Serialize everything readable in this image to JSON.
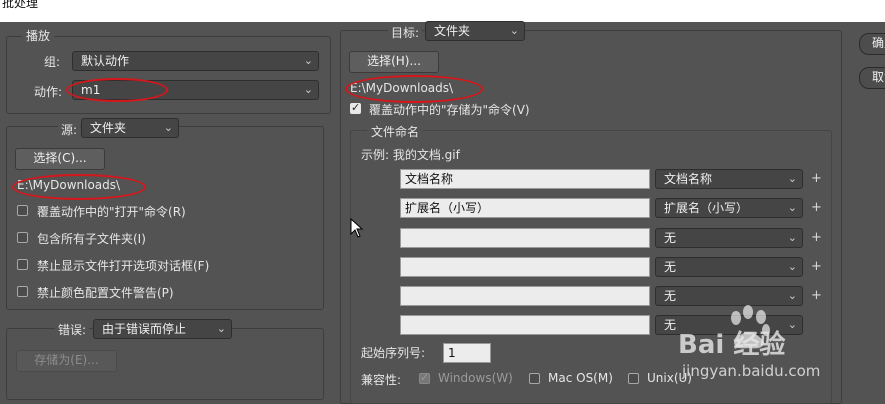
{
  "window_title": "批处理",
  "playback": {
    "legend": "播放",
    "group_label": "组:",
    "group_value": "默认动作",
    "action_label": "动作:",
    "action_value": "m1"
  },
  "source": {
    "label": "源:",
    "value": "文件夹",
    "choose_button": "选择(C)...",
    "path": "E:\\MyDownloads\\",
    "options": [
      "覆盖动作中的\"打开\"命令(R)",
      "包含所有子文件夹(I)",
      "禁止显示文件打开选项对话框(F)",
      "禁止颜色配置文件警告(P)"
    ]
  },
  "errors": {
    "label": "错误:",
    "value": "由于错误而停止",
    "save_as_button": "存储为(E)..."
  },
  "destination": {
    "label": "目标:",
    "value": "文件夹",
    "choose_button": "选择(H)...",
    "path": "E:\\MyDownloads\\",
    "override_save_as": "覆盖动作中的\"存储为\"命令(V)",
    "override_checked": true
  },
  "file_naming": {
    "legend": "文件命名",
    "example": "示例: 我的文档.gif",
    "rows": [
      {
        "text": "文档名称",
        "select": "文档名称"
      },
      {
        "text": "扩展名（小写）",
        "select": "扩展名（小写）"
      },
      {
        "text": "",
        "select": "无"
      },
      {
        "text": "",
        "select": "无"
      },
      {
        "text": "",
        "select": "无"
      },
      {
        "text": "",
        "select": "无"
      }
    ],
    "serial_label": "起始序列号:",
    "serial_value": "1",
    "compat_label": "兼容性:",
    "compat": [
      {
        "label": "Windows(W)",
        "checked": true,
        "disabled": true
      },
      {
        "label": "Mac OS(M)",
        "checked": false,
        "disabled": false
      },
      {
        "label": "Unix(U)",
        "checked": false,
        "disabled": false
      }
    ]
  },
  "side_buttons": {
    "ok": "确定",
    "cancel": "取消"
  },
  "watermark": {
    "brand": "Bai 经验",
    "url": "jingyan.baidu.com"
  },
  "colors": {
    "panel_bg": "#535353",
    "annotation_red": "#d6161a"
  }
}
